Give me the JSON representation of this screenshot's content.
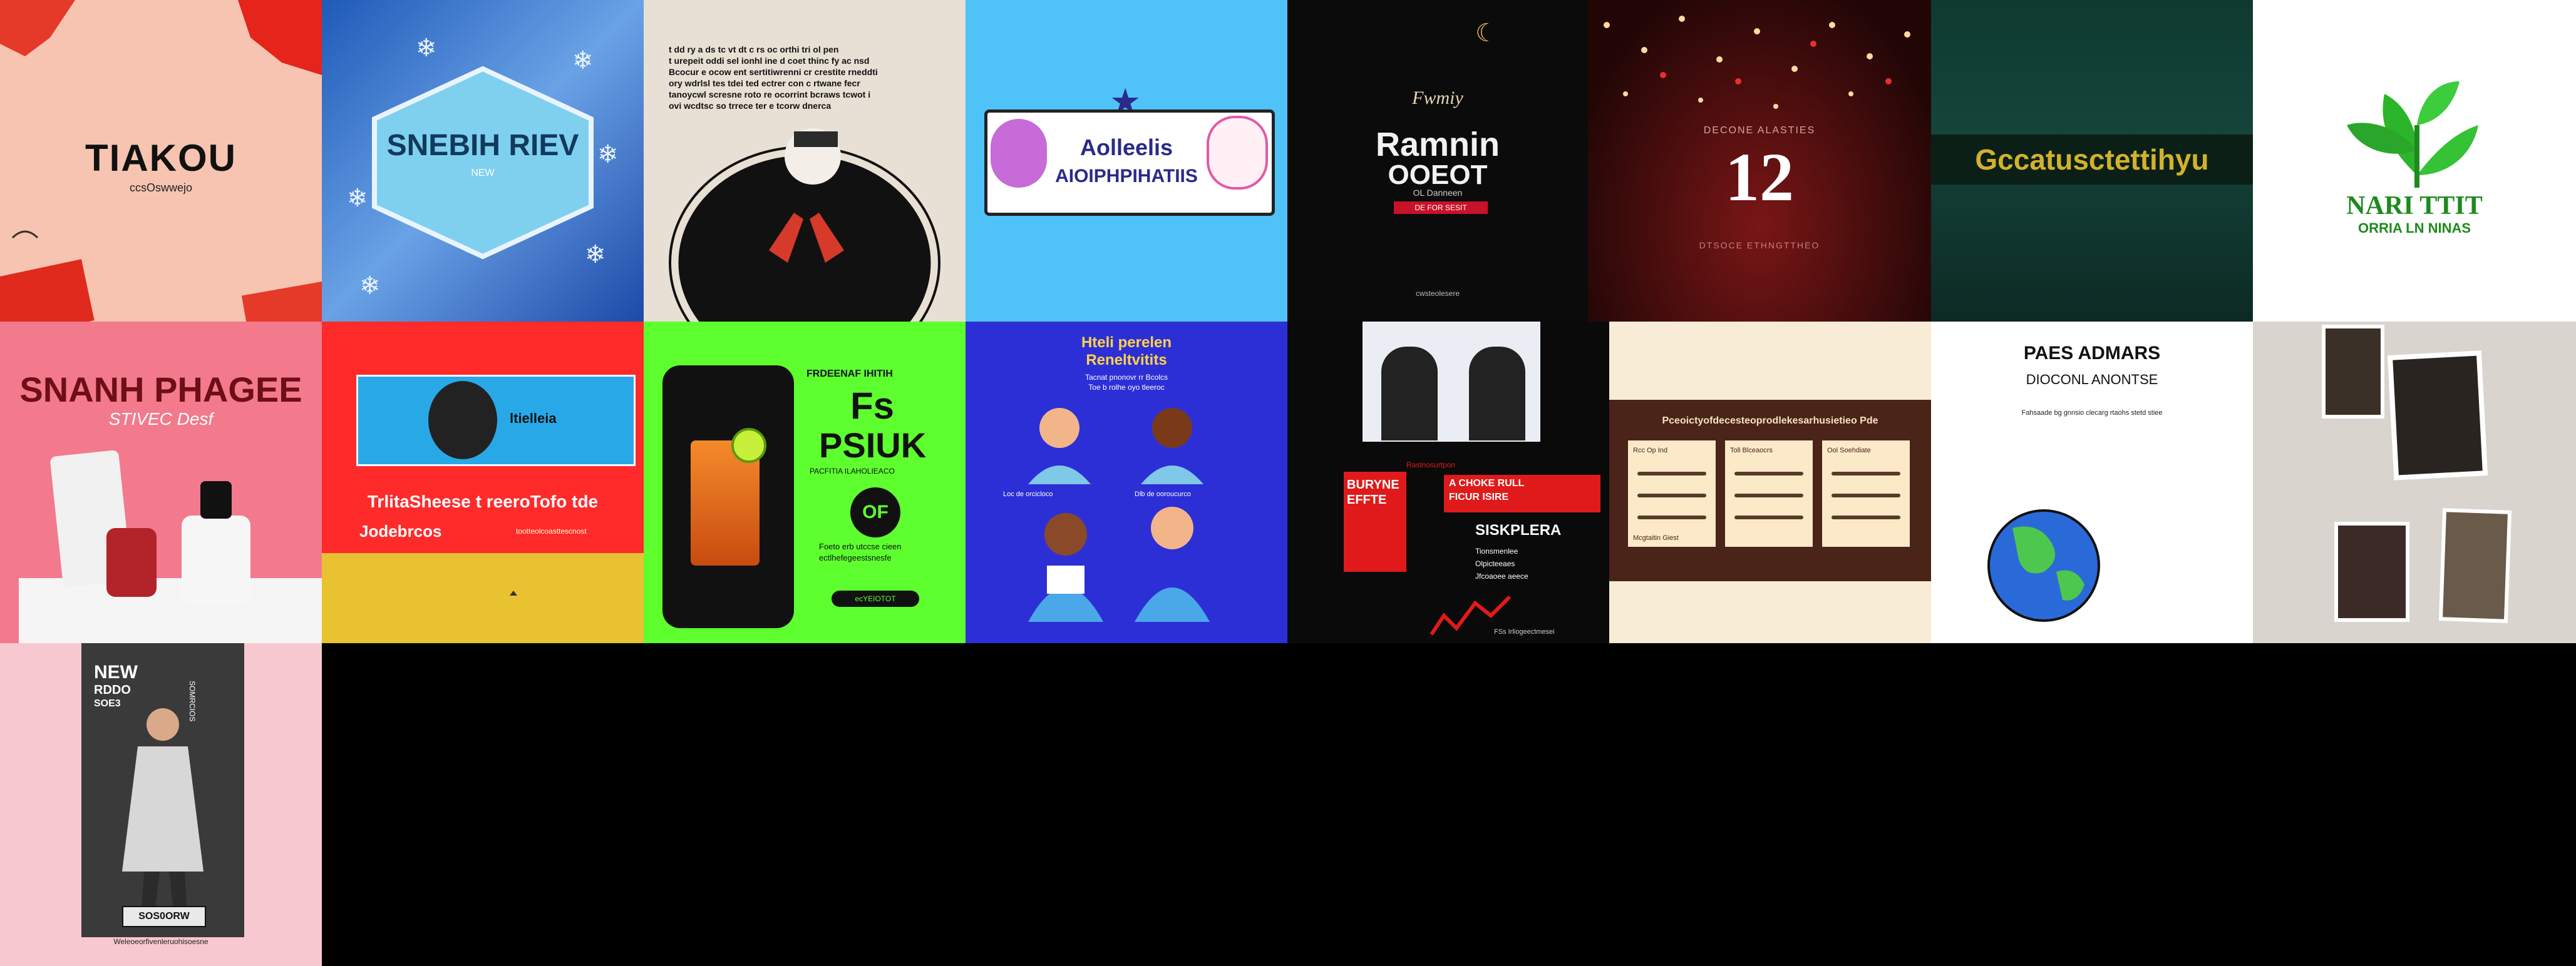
{
  "tiles": [
    {
      "id": "t1",
      "title": "TIAKOU",
      "subtitle": "ccsOswwejo",
      "bg": "#f6c4b0"
    },
    {
      "id": "t2",
      "title": "SNEBIH RIEV",
      "badge": "NEW",
      "bg": "#2a64b8"
    },
    {
      "id": "t3",
      "text_lines": [
        "t dd ry a ds tc vt dt c rs oc orthi tri ol pen",
        "t urepeit oddi sel ionhl ine d coet thinc fy ac nsd",
        "Bcocur e ocow ent sertitiwrenni cr crestite rneddti",
        "ory wdrlsl tes tdei ted ectrer con c rtwane fecr",
        "tanoycwl scresne roto re ocorrint bcraws tcwot i",
        "ovi wcdtsc so trrece ter e tcorw dnerca"
      ],
      "bg": "#e8e0d4"
    },
    {
      "id": "t4",
      "line1": "Aolleelis",
      "line2": "AIOIPHPIHATIIS",
      "bg": "#4fc3f7"
    },
    {
      "id": "t5",
      "script": "Fwmiy",
      "title1": "Ramnin",
      "title2": "OOEOT",
      "small": "OL Danneen",
      "badge": "DE FOR SESIT",
      "footer": "cwsteolesere",
      "bg": "#0b0b0b"
    },
    {
      "id": "t6",
      "top": "DECONE ALASTIES",
      "number": "12",
      "bottom": "DTSOCE ETHNGTTHEO",
      "bg": "#3b0d0d"
    },
    {
      "id": "t7",
      "banner": "Gccatusctettihyu",
      "bg": "#143a2f"
    },
    {
      "id": "t8",
      "brand": "NARI TTIT",
      "sub": "ORRIA LN NINAS",
      "bg": "#ffffff"
    },
    {
      "id": "t9",
      "title": "SNANH PHAGEE",
      "subtitle": "STIVEC Desf",
      "bg": "#f27a8c"
    },
    {
      "id": "t10",
      "tag": "ltielleia",
      "headline": "TrlitaSheese t reeroTofo tde",
      "sub": "Jodebrcos",
      "small": "tootteolcoasttescnost",
      "bg": "#ff2a2a"
    },
    {
      "id": "t11",
      "top": "FRDEENAF IHITIH",
      "big1": "Fs",
      "big2": "PSIUK",
      "small": "PACFITIA ILAHOLIEACO",
      "badge": "OF",
      "text": "Foeto erb utccse cieen",
      "text2": "ectlhefegeestsnesfe",
      "button": "ecYEIOTOT",
      "bg": "#5dff2e"
    },
    {
      "id": "t12",
      "title1": "Hteli perelen",
      "title2": "Reneltvitits",
      "lines": [
        "Tacnat pnonovr rr Bcolcs",
        "Toe b rolhe oyo tleeroc"
      ],
      "cap1": "Loc de orcicloco",
      "cap2": "Dlb de ooroucurco",
      "bg": "#2d2fd6"
    },
    {
      "id": "t13",
      "left_title": "BURYNE",
      "left_title2": "EFFTE",
      "red_title": "A CHOKE RULL",
      "red_title2": "FICUR ISIRE",
      "big": "SISKPLERA",
      "labels": [
        "Rastnosurtpon",
        "Tionsmenlee",
        "Olpicteeaes",
        "Jfcoaoee aeece"
      ],
      "footer": "FSs Irliogeectmesei",
      "bg": "#0a0a0a"
    },
    {
      "id": "t14",
      "title": "Pceoictyofdecesteoprodlekesarhusietieo Pde",
      "rows": [
        "Rcc Op Ind",
        "Toll Blceaocrs",
        "Ool Soehdiate",
        "Mcgtaitin Giest"
      ],
      "bg": "#f8ecd6"
    },
    {
      "id": "t15",
      "title": "PAES ADMARS",
      "subtitle": "DIOCONL ANONTSE",
      "small": "Fahsaade bg gnnsio clecarg rtaohs stetd stiee",
      "bg": "#ffffff"
    },
    {
      "id": "t16",
      "bg": "#d9d4cd"
    },
    {
      "id": "t17",
      "title1": "NEW",
      "title2": "RDDO",
      "title3": "SOE3",
      "side": "SOMRCIOS",
      "button": "SOS0ORW",
      "footer": "Weleoeorfivenleruohisoesne",
      "bg": "#f7c8d0"
    }
  ],
  "colors": {
    "red": "#e52020",
    "cream": "#fbe9c8"
  }
}
